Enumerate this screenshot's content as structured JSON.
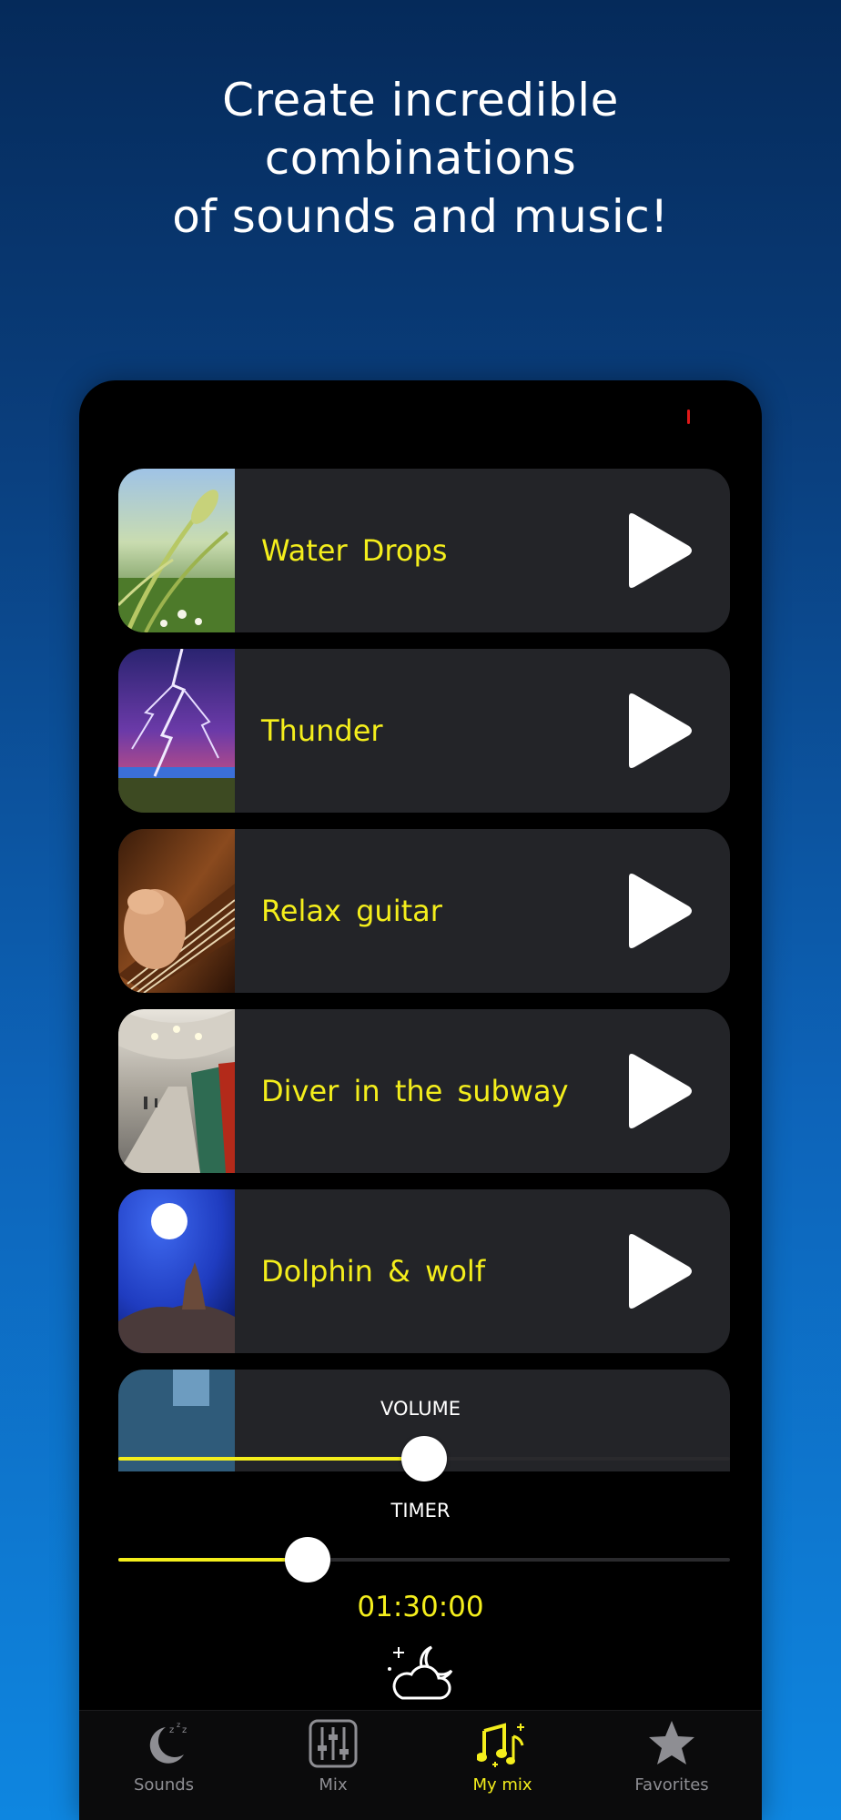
{
  "headline": {
    "line1": "Create incredible",
    "line2": "combinations",
    "line3": "of sounds and music!"
  },
  "colors": {
    "accent": "#f4ee1c",
    "row_background": "#232428",
    "inactive_tab": "#8e8e93"
  },
  "sounds": [
    {
      "label": "Water Drops",
      "image": "wheat-field-image",
      "action_icon": "play-icon"
    },
    {
      "label": "Thunder",
      "image": "lightning-storm-image",
      "action_icon": "play-icon"
    },
    {
      "label": "Relax guitar",
      "image": "guitar-strings-image",
      "action_icon": "play-icon"
    },
    {
      "label": "Diver in the subway",
      "image": "subway-station-image",
      "action_icon": "play-icon"
    },
    {
      "label": "Dolphin & wolf",
      "image": "wolf-moon-image",
      "action_icon": "play-icon"
    }
  ],
  "volume": {
    "label": "VOLUME",
    "level": 0.5
  },
  "timer": {
    "label": "TIMER",
    "level": 0.31,
    "value": "01:30:00",
    "icon": "moon-cloud-icon"
  },
  "tabs": [
    {
      "label": "Sounds",
      "icon": "sleeping-moon-icon",
      "active": false
    },
    {
      "label": "Mix",
      "icon": "mixer-sliders-icon",
      "active": false
    },
    {
      "label": "My mix",
      "icon": "music-notes-icon",
      "active": true
    },
    {
      "label": "Favorites",
      "icon": "star-icon",
      "active": false
    }
  ]
}
